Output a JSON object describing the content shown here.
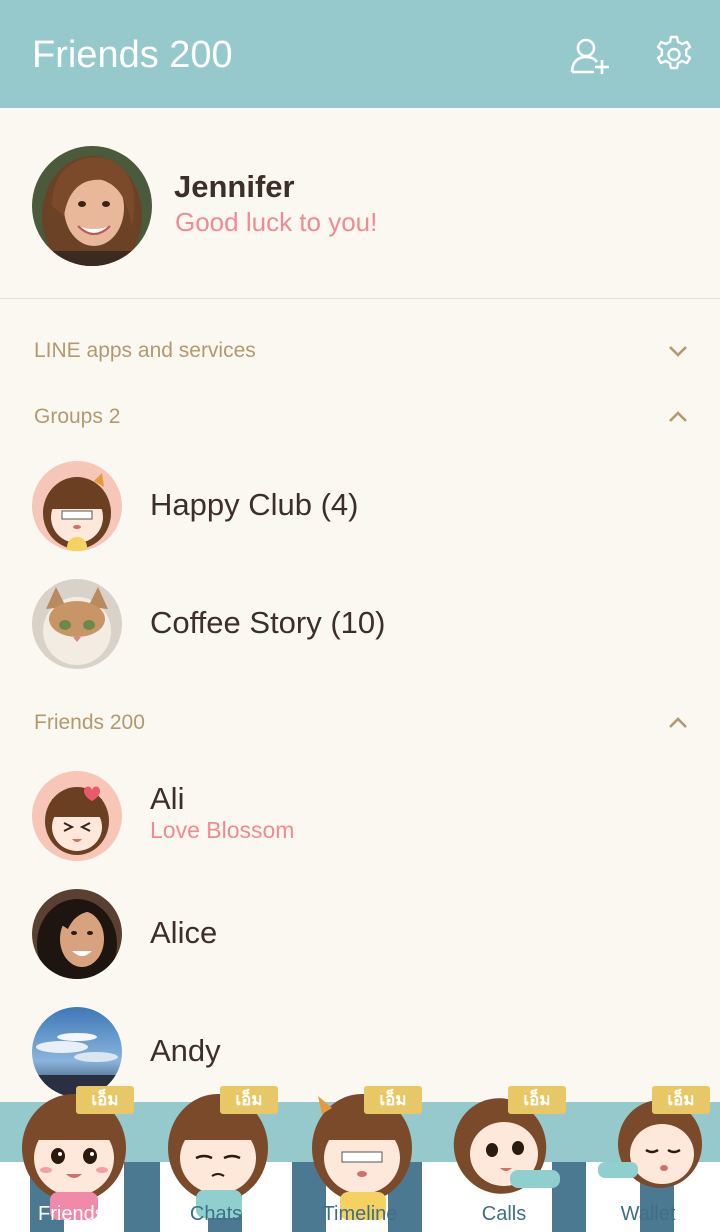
{
  "header": {
    "title": "Friends 200",
    "add_friend_icon": "add-friend-icon",
    "settings_icon": "gear-icon",
    "background": "#95c9cb"
  },
  "profile": {
    "name": "Jennifer",
    "status": "Good luck to you!"
  },
  "sections": {
    "apps": {
      "label": "LINE apps and services",
      "state": "collapsed"
    },
    "groups": {
      "label": "Groups 2",
      "state": "expanded"
    },
    "friends": {
      "label": "Friends 200",
      "state": "expanded"
    }
  },
  "groups": [
    {
      "name": "Happy Club (4)"
    },
    {
      "name": "Coffee Story (10)"
    }
  ],
  "friends": [
    {
      "name": "Ali",
      "status": "Love Blossom"
    },
    {
      "name": "Alice",
      "status": ""
    },
    {
      "name": "Andy",
      "status": ""
    }
  ],
  "tabs": [
    {
      "label": "Friends",
      "badge": "เอ็ม",
      "active": true
    },
    {
      "label": "Chats",
      "badge": "เอ็ม",
      "active": false
    },
    {
      "label": "Timeline",
      "badge": "เอ็ม",
      "active": false
    },
    {
      "label": "Calls",
      "badge": "เอ็ม",
      "active": false
    },
    {
      "label": "Wallet",
      "badge": "เอ็ม",
      "active": false
    }
  ],
  "colors": {
    "accent": "#95c9cb",
    "status_pink": "#f08b93",
    "section_gold": "#b39a6e",
    "tab_stripe": "#4b7992",
    "badge_yellow": "#e8c766"
  }
}
